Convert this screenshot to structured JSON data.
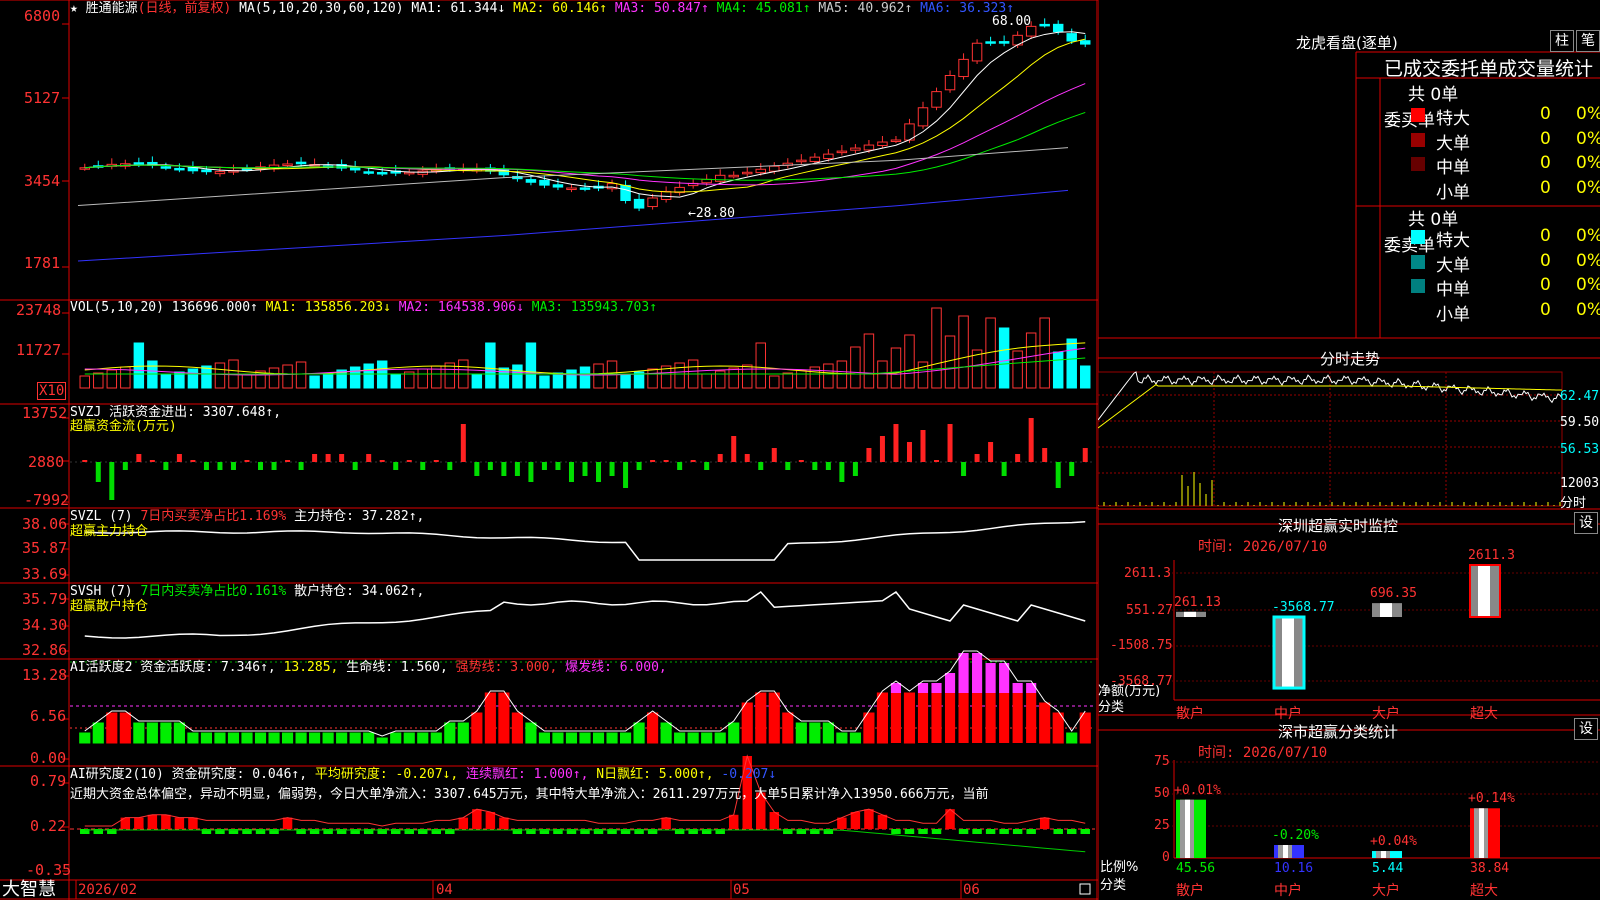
{
  "colors": {
    "up": "#ff3333",
    "down": "#00ffff",
    "green": "#00ee00",
    "axis": "#cc0000",
    "yellow": "#ffff00",
    "magenta": "#ff33ff",
    "white": "#ffffff",
    "blue": "#3333ff",
    "gray": "#aaaaaa"
  },
  "main": {
    "star_icon": "★",
    "stock_name": "胜通能源",
    "period": "(日线，前复权)",
    "ma_params": "MA(5,10,20,30,60,120)",
    "ma1": "MA1: 61.344↓",
    "ma2": "MA2: 60.146↑",
    "ma3": "MA3: 50.847↑",
    "ma4": "MA4: 45.081↑",
    "ma5": "MA5: 40.962↑",
    "ma6": "MA6: 36.323↑",
    "high_label": "68.00",
    "low_label": "←28.80",
    "y_labels": [
      "6800",
      "5127",
      "3454",
      "1781"
    ]
  },
  "vol": {
    "title": "VOL(5,10,20)",
    "value": "136696.000↑",
    "ma1": "MA1: 135856.203↓",
    "ma2": "MA2: 164538.906↓",
    "ma3": "MA3: 135943.703↑",
    "y_labels": [
      "23748",
      "11727"
    ],
    "unit": "X10"
  },
  "svzj": {
    "title": "SVZJ  活跃资金进出: 3307.648↑,",
    "subtitle": "超赢资金流(万元)",
    "y_labels": [
      "13752",
      "2880",
      "-7992"
    ],
    "bars": [
      0,
      -3,
      -6,
      -1,
      1,
      0,
      -1,
      1,
      0,
      -1,
      -1,
      -1,
      0,
      -1,
      -1,
      0,
      -1,
      1,
      1,
      1,
      -1,
      1,
      0,
      -1,
      0,
      -1,
      0,
      -1,
      6,
      -2,
      -1,
      -2,
      -2,
      -3,
      -1,
      -1,
      -3,
      -2,
      -3,
      -2,
      -4,
      -1,
      0,
      0,
      -1,
      0,
      -1,
      1,
      4,
      1,
      -1,
      2,
      -1,
      0,
      -1,
      -1,
      -3,
      -2,
      2,
      4,
      6,
      3,
      5,
      0,
      6,
      -2,
      1,
      3,
      -2,
      1,
      7,
      2,
      -4,
      -2,
      2
    ]
  },
  "svzl": {
    "title": "SVZL (7)",
    "t1": "7日内买卖净占比1.169%",
    "t2": "主力持仓: 37.282↑,",
    "subtitle": "超赢主力持仓",
    "y_labels": [
      "38.06",
      "35.87",
      "33.69"
    ]
  },
  "svsh": {
    "title": "SVSH (7)",
    "t1": "7日内买卖净占比0.161%",
    "t2": "散户持仓: 34.062↑,",
    "subtitle": "超赢散户持仓",
    "y_labels": [
      "35.79",
      "34.30",
      "32.86"
    ]
  },
  "ai1": {
    "title": "AI活跃度2 资金活跃度: 7.346↑,",
    "t1": "13.285,",
    "t2": "生命线: 1.560,",
    "t3": "强势线: 3.000,",
    "t4": "爆发线: 6.000,",
    "y_labels": [
      "13.28",
      "6.56",
      "0.00"
    ],
    "bars": [
      1,
      2,
      3,
      3,
      2,
      2,
      2,
      2,
      1,
      1,
      1,
      1,
      1,
      1,
      1,
      1,
      1,
      1,
      1,
      1,
      1,
      1,
      0.5,
      1,
      1,
      1,
      1,
      2,
      2,
      3,
      5,
      5,
      3,
      2,
      1,
      1,
      1,
      1,
      1,
      1,
      1,
      2,
      3,
      2,
      1,
      1,
      1,
      1,
      2,
      4,
      5,
      5,
      3,
      2,
      2,
      2,
      1,
      1,
      3,
      5,
      6,
      5,
      6,
      6,
      7,
      9,
      9,
      8,
      8,
      6,
      6,
      4,
      3,
      1,
      3
    ]
  },
  "ai2": {
    "title": "AI研究度2(10)",
    "t1": "资金研究度: 0.046↑,",
    "t2": "平均研究度: -0.207↓,",
    "t3": "连续飘红: 1.000↑,",
    "t4": "N日飘红: 5.000↑,",
    "t5": "-0.207↓",
    "comment": "近期大资金总体偏空，异动不明显，偏弱势，今日大单净流入：3307.645万元，其中特大单净流入：2611.297万元，大单5日累计净入13950.666万元，当前",
    "y_labels": [
      "0.79",
      "0.22",
      "-0.35"
    ],
    "bars": [
      0,
      0,
      0,
      0.3,
      0.3,
      0.4,
      0.4,
      0.3,
      0.3,
      0.2,
      0.2,
      0.2,
      0.2,
      0.2,
      0.2,
      0.3,
      0.2,
      0.2,
      0.1,
      0.1,
      0.1,
      0.1,
      0,
      0.1,
      0.1,
      0.1,
      0.2,
      0.2,
      0.3,
      0.6,
      0.5,
      0.3,
      0.2,
      0.2,
      0.2,
      0.2,
      0.2,
      0.2,
      0.1,
      0.1,
      0.1,
      0.2,
      0.2,
      0.3,
      0.2,
      0.2,
      0.2,
      0.2,
      0.4,
      2.5,
      1.2,
      0.5,
      0.2,
      0.2,
      0.1,
      0.1,
      0.3,
      0.5,
      0.6,
      0.4,
      0.2,
      0.2,
      0.1,
      0.1,
      0.6,
      0.2,
      0.2,
      0.2,
      0.1,
      0.1,
      0.2,
      0.3,
      0.2,
      0.2,
      0.1
    ]
  },
  "footer": {
    "logo": "大智慧",
    "dates": [
      "2026/02",
      "04",
      "05",
      "06"
    ]
  },
  "right": {
    "dragon_title": "龙虎看盘(逐单)",
    "btn_bar": "柱",
    "btn_pen": "笔",
    "tabs_header": "已成交委托单成交量统计",
    "buy_group": "委买单",
    "sell_group": "委卖单",
    "buy_total": "共 0单",
    "sell_total": "共 0单",
    "buy_rows": [
      {
        "label": "特大",
        "count": "0",
        "pct": "0%",
        "color": "#ff0000"
      },
      {
        "label": "大单",
        "count": "0",
        "pct": "0%",
        "color": "#990000"
      },
      {
        "label": "中单",
        "count": "0",
        "pct": "0%",
        "color": "#660000"
      },
      {
        "label": "小单",
        "count": "0",
        "pct": "0%",
        "color": ""
      }
    ],
    "sell_rows": [
      {
        "label": "特大",
        "count": "0",
        "pct": "0%",
        "color": "#00ffff"
      },
      {
        "label": "大单",
        "count": "0",
        "pct": "0%",
        "color": "#008888"
      },
      {
        "label": "中单",
        "count": "0",
        "pct": "0%",
        "color": "#008080"
      },
      {
        "label": "小单",
        "count": "0",
        "pct": "0%",
        "color": ""
      }
    ],
    "intraday_title": "分时走势",
    "intraday_labels": [
      "62.47",
      "59.50",
      "56.53",
      "12003",
      "分时"
    ],
    "sz_title": "深圳超赢实时监控",
    "sz_btn": "设",
    "sz_time": "时间: 2026/07/10",
    "sz_y": [
      "2611.3",
      "551.27",
      "-1508.75",
      "-3568.77"
    ],
    "sz_unit_1": "净额(万元)",
    "sz_unit_2": "分类",
    "sz_bars": [
      {
        "cat": "散户",
        "label": "261.13",
        "value": 261.13
      },
      {
        "cat": "中户",
        "label": "-3568.77",
        "value": -3568.77
      },
      {
        "cat": "大户",
        "label": "696.35",
        "value": 696.35
      },
      {
        "cat": "超大",
        "label": "2611.3",
        "value": 2611.3
      }
    ],
    "dist_title": "深市超赢分类统计",
    "dist_btn": "设",
    "dist_time": "时间: 2026/07/10",
    "dist_y": [
      "75",
      "50",
      "25",
      "0"
    ],
    "dist_unit_1": "比例%",
    "dist_unit_2": "分类",
    "dist_bars": [
      {
        "cat": "散户",
        "top": "+0.01%",
        "value": 45.56,
        "label": "45.56"
      },
      {
        "cat": "中户",
        "top": "-0.20%",
        "value": 10.16,
        "label": "10.16"
      },
      {
        "cat": "大户",
        "top": "+0.04%",
        "value": 5.44,
        "label": "5.44"
      },
      {
        "cat": "超大",
        "top": "+0.14%",
        "value": 38.84,
        "label": "38.84"
      }
    ]
  }
}
